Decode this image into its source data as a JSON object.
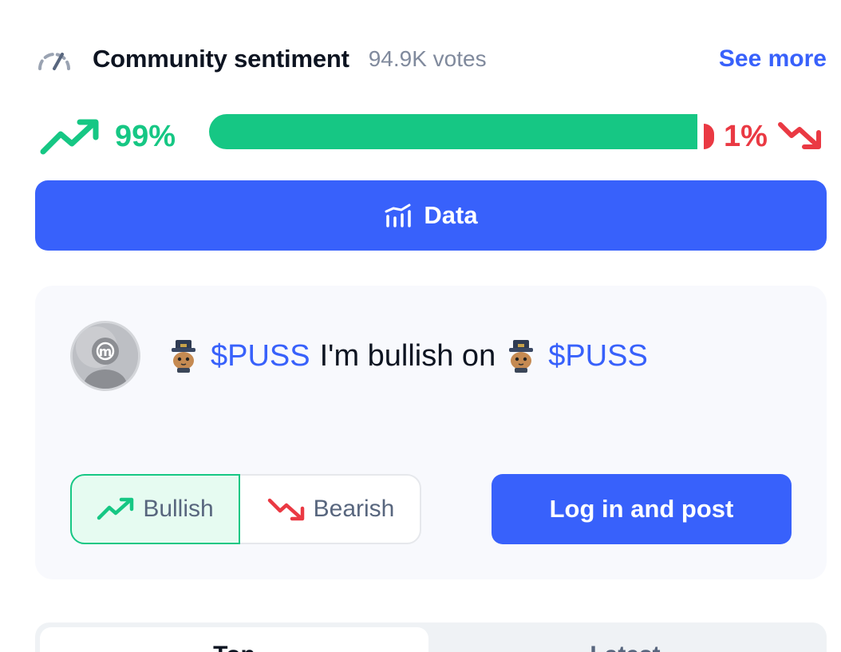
{
  "header": {
    "title": "Community sentiment",
    "votes": "94.9K votes",
    "see_more": "See more"
  },
  "sentiment": {
    "bullish_pct": "99%",
    "bearish_pct": "1%",
    "bullish_fraction": 0.99,
    "bearish_fraction": 0.01
  },
  "data_button": {
    "label": "Data"
  },
  "post": {
    "ticker": "$PUSS",
    "text": "I'm bullish on",
    "ticker_end": "$PUSS"
  },
  "toggle": {
    "bullish_label": "Bullish",
    "bearish_label": "Bearish",
    "selected": "Bullish"
  },
  "login_button": {
    "label": "Log in and post"
  },
  "tabs": [
    {
      "label": "Top"
    },
    {
      "label": "Latest"
    }
  ],
  "colors": {
    "accent": "#3861fb",
    "bullish": "#16c784",
    "bearish": "#ea3943"
  }
}
